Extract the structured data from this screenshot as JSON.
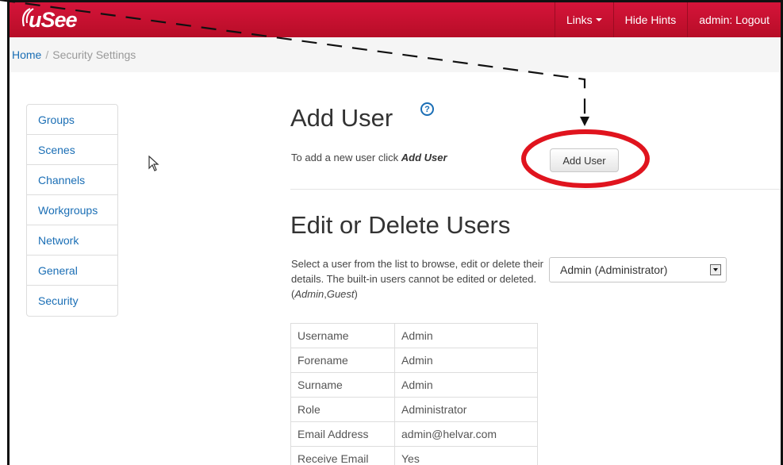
{
  "navbar": {
    "brand": "uSee",
    "links_label": "Links",
    "hide_hints_label": "Hide Hints",
    "logout_label": "admin: Logout"
  },
  "breadcrumb": {
    "home": "Home",
    "separator": "/",
    "current": "Security Settings"
  },
  "sidebar": {
    "items": [
      {
        "label": "Groups"
      },
      {
        "label": "Scenes"
      },
      {
        "label": "Channels"
      },
      {
        "label": "Workgroups"
      },
      {
        "label": "Network"
      },
      {
        "label": "General"
      },
      {
        "label": "Security"
      }
    ]
  },
  "add_user": {
    "title": "Add User",
    "help_icon": "?",
    "instruction_prefix": "To add a new user click ",
    "instruction_emphasis": "Add User",
    "button_label": "Add User"
  },
  "edit_users": {
    "title": "Edit or Delete Users",
    "description_prefix": "Select a user from the list to browse, edit or delete their details. The built-in users cannot be edited or deleted. (",
    "builtin_a": "Admin",
    "builtin_sep": ",",
    "builtin_b": "Guest",
    "description_suffix": ")",
    "selected_user": "Admin (Administrator)",
    "details": [
      {
        "key": "Username",
        "value": "Admin"
      },
      {
        "key": "Forename",
        "value": "Admin"
      },
      {
        "key": "Surname",
        "value": "Admin"
      },
      {
        "key": "Role",
        "value": "Administrator"
      },
      {
        "key": "Email Address",
        "value": "admin@helvar.com"
      },
      {
        "key": "Receive Email",
        "value": "Yes"
      }
    ]
  },
  "colors": {
    "navbar": "#c8102e",
    "link": "#1a6eb5",
    "annotation_circle": "#e0141e"
  }
}
